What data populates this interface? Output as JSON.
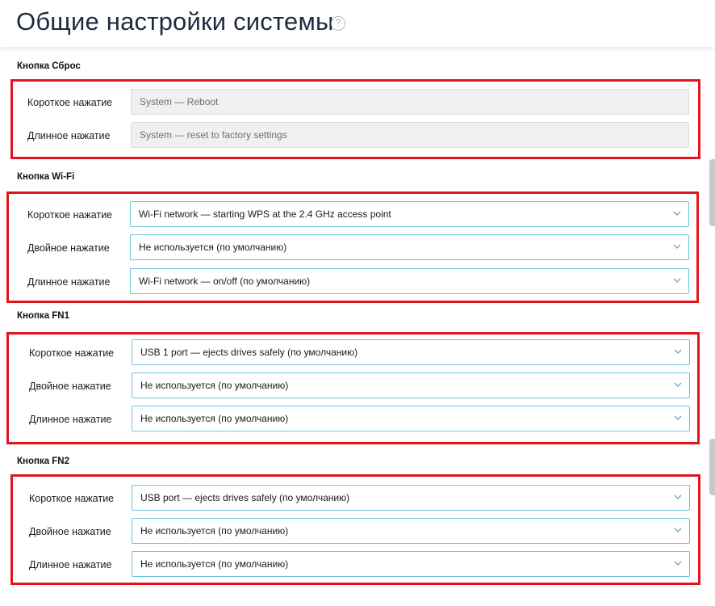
{
  "page": {
    "title": "Общие настройки системы",
    "help_icon": "question-circle-icon",
    "help_glyph": "?"
  },
  "reset": {
    "title": "Кнопка Сброс",
    "short_label": "Короткое нажатие",
    "short_value": "System — Reboot",
    "long_label": "Длинное нажатие",
    "long_value": "System — reset to factory settings"
  },
  "wifi": {
    "title": "Кнопка Wi-Fi",
    "short_label": "Короткое нажатие",
    "short_value": "Wi-Fi network — starting WPS at the 2.4 GHz access point",
    "double_label": "Двойное нажатие",
    "double_value": "Не используется (по умолчанию)",
    "long_label": "Длинное нажатие",
    "long_value": "Wi-Fi network — on/off (по умолчанию)"
  },
  "fn1": {
    "title": "Кнопка FN1",
    "short_label": "Короткое нажатие",
    "short_value": "USB 1 port — ejects drives safely (по умолчанию)",
    "double_label": "Двойное нажатие",
    "double_value": "Не используется (по умолчанию)",
    "long_label": "Длинное нажатие",
    "long_value": "Не используется (по умолчанию)"
  },
  "fn2": {
    "title": "Кнопка FN2",
    "short_label": "Короткое нажатие",
    "short_value": "USB port — ejects drives safely (по умолчанию)",
    "double_label": "Двойное нажатие",
    "double_value": "Не используется (по умолчанию)",
    "long_label": "Длинное нажатие",
    "long_value": "Не используется (по умолчанию)"
  },
  "colors": {
    "highlight_frame": "#e0161f",
    "select_border": "#6ec1e6",
    "title": "#1e2b3f"
  }
}
